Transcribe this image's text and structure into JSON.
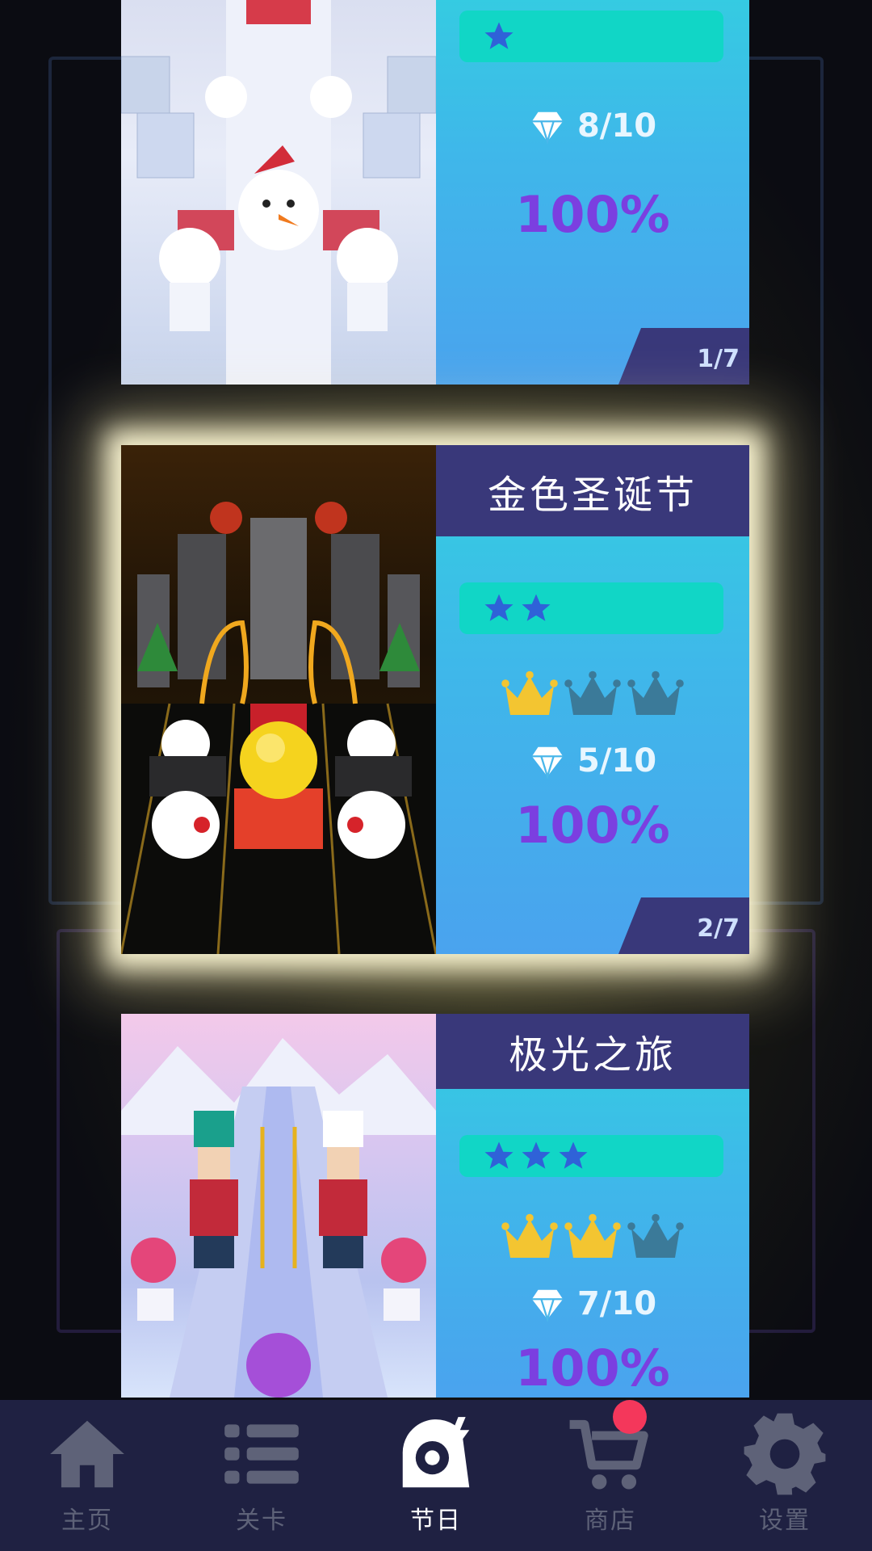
{
  "levels": [
    {
      "title": "",
      "stars": 1,
      "crowns": null,
      "gems": "8/10",
      "percent": "100%",
      "page": "1/7"
    },
    {
      "title": "金色圣诞节",
      "stars": 2,
      "crowns": 1,
      "gems": "5/10",
      "percent": "100%",
      "page": "2/7"
    },
    {
      "title": "极光之旅",
      "stars": 3,
      "crowns": 2,
      "gems": "7/10",
      "percent": "100%"
    }
  ],
  "nav": {
    "home": "主页",
    "levels": "关卡",
    "holiday": "节日",
    "shop": "商店",
    "settings": "设置"
  },
  "colors": {
    "title_bar": "#39387a",
    "stars_bar": "#11d6c6",
    "star": "#2f62d8",
    "crown_gold": "#f3c531",
    "crown_dim": "#3b7a99",
    "percent": "#7b3fe0",
    "nav_bg": "#1f2142",
    "badge": "#f4375b"
  }
}
